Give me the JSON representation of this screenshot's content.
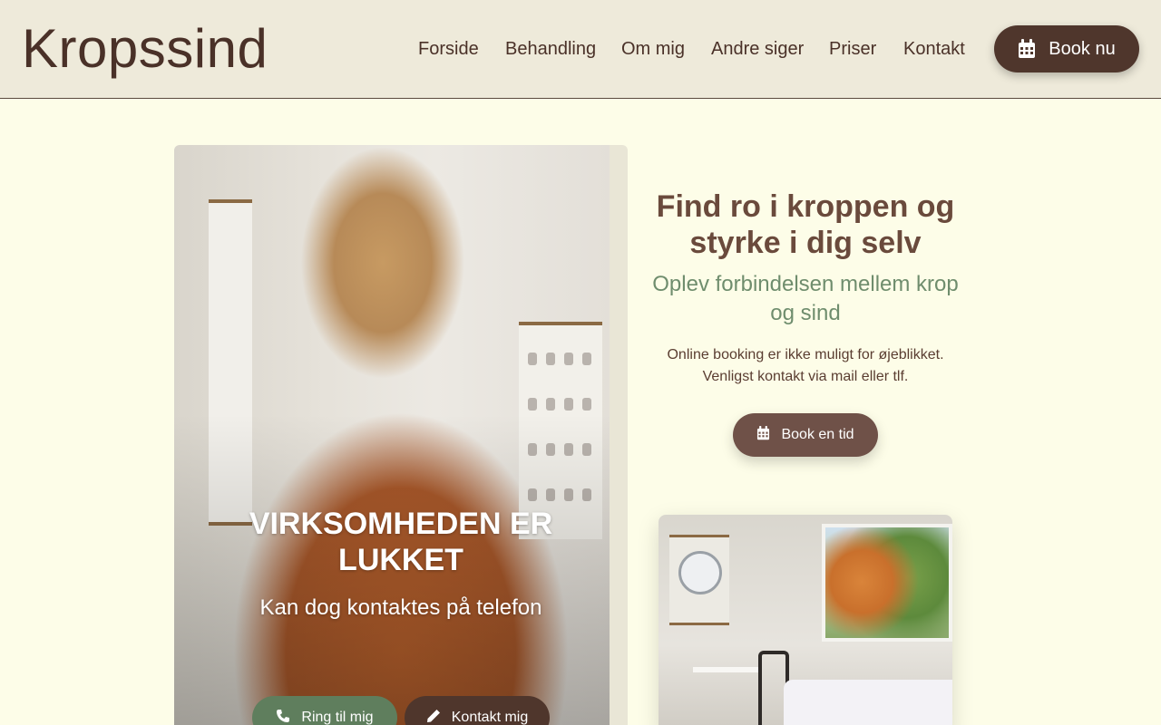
{
  "brand": {
    "name": "Kropssind"
  },
  "nav": {
    "items": [
      "Forside",
      "Behandling",
      "Om mig",
      "Andre siger",
      "Priser",
      "Kontakt"
    ],
    "book_button": {
      "label": "Book nu",
      "icon": "calendar-icon"
    }
  },
  "hero": {
    "title": "VIRKSOMHEDEN ER LUKKET",
    "subtitle": "Kan dog kontaktes på telefon",
    "call_button": {
      "label": "Ring til mig",
      "icon": "phone-icon"
    },
    "contact_button": {
      "label": "Kontakt mig",
      "icon": "pencil-icon"
    }
  },
  "intro": {
    "title": "Find ro i kroppen og styrke i dig selv",
    "subtitle": "Oplev forbindelsen mellem krop og sind",
    "note_line1": "Online booking er ikke muligt for øjeblikket.",
    "note_line2": "Venligst kontakt via mail eller tlf.",
    "book_button": {
      "label": "Book en tid",
      "icon": "calendar-icon"
    }
  },
  "colors": {
    "background": "#fdfde8",
    "header": "#eeeada",
    "brown": "#4f362c",
    "green": "#5f7e5d",
    "accent_green_text": "#6f8d6d"
  }
}
